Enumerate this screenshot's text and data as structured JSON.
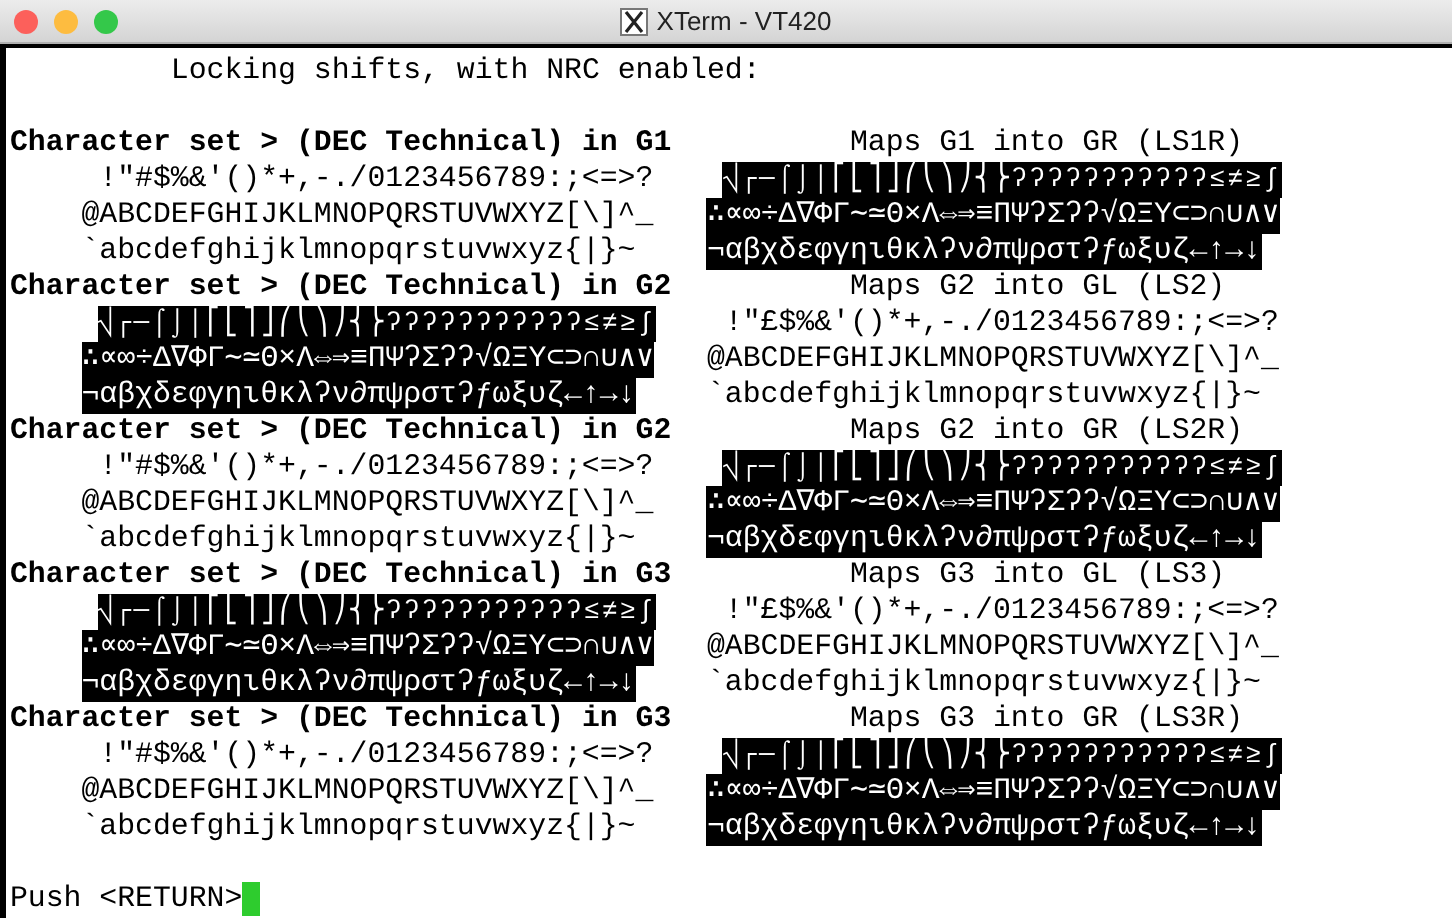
{
  "window": {
    "title": "XTerm - VT420"
  },
  "terminal": {
    "intro": "Locking shifts, with NRC enabled:",
    "blocks": [
      {
        "heading": "Character set > (DEC Technical) in G1",
        "map_label": "Maps G1 into GR (LS1R)",
        "left": {
          "kind": "normal",
          "rows": [
            "!\"#$%&'()*+,-./0123456789:;<=>?",
            "@ABCDEFGHIJKLMNOPQRSTUVWXYZ[\\]^_",
            "`abcdefghijklmnopqrstuvwxyz{|}~"
          ]
        },
        "right": {
          "kind": "inverse",
          "rows": [
            "⎷┌─⌠⌡│⎡⎣⎤⎦⎛⎝⎞⎠⎨⎬ʔʔʔʔʔʔʔʔʔʔʔ≤≠≥∫",
            "∴∝∞÷Δ∇ΦΓ∼≃Θ×Λ⇔⇒≡ΠΨʔΣʔʔ√ΩΞΥ⊂⊃∩∪∧∨",
            "¬αβχδεφγηιθκλʔν∂πψρστʔƒωξυζ←↑→↓"
          ]
        }
      },
      {
        "heading": "Character set > (DEC Technical) in G2",
        "map_label": "Maps G2 into GL (LS2)",
        "left": {
          "kind": "inverse",
          "rows": [
            "⎷┌─⌠⌡│⎡⎣⎤⎦⎛⎝⎞⎠⎨⎬ʔʔʔʔʔʔʔʔʔʔʔ≤≠≥∫",
            "∴∝∞÷Δ∇ΦΓ∼≃Θ×Λ⇔⇒≡ΠΨʔΣʔʔ√ΩΞΥ⊂⊃∩∪∧∨",
            "¬αβχδεφγηιθκλʔν∂πψρστʔƒωξυζ←↑→↓"
          ]
        },
        "right": {
          "kind": "normal",
          "rows": [
            "!\"£$%&'()*+,-./0123456789:;<=>?",
            "@ABCDEFGHIJKLMNOPQRSTUVWXYZ[\\]^_",
            "`abcdefghijklmnopqrstuvwxyz{|}~"
          ]
        }
      },
      {
        "heading": "Character set > (DEC Technical) in G2",
        "map_label": "Maps G2 into GR (LS2R)",
        "left": {
          "kind": "normal",
          "rows": [
            "!\"#$%&'()*+,-./0123456789:;<=>?",
            "@ABCDEFGHIJKLMNOPQRSTUVWXYZ[\\]^_",
            "`abcdefghijklmnopqrstuvwxyz{|}~"
          ]
        },
        "right": {
          "kind": "inverse",
          "rows": [
            "⎷┌─⌠⌡│⎡⎣⎤⎦⎛⎝⎞⎠⎨⎬ʔʔʔʔʔʔʔʔʔʔʔ≤≠≥∫",
            "∴∝∞÷Δ∇ΦΓ∼≃Θ×Λ⇔⇒≡ΠΨʔΣʔʔ√ΩΞΥ⊂⊃∩∪∧∨",
            "¬αβχδεφγηιθκλʔν∂πψρστʔƒωξυζ←↑→↓"
          ]
        }
      },
      {
        "heading": "Character set > (DEC Technical) in G3",
        "map_label": "Maps G3 into GL (LS3)",
        "left": {
          "kind": "inverse",
          "rows": [
            "⎷┌─⌠⌡│⎡⎣⎤⎦⎛⎝⎞⎠⎨⎬ʔʔʔʔʔʔʔʔʔʔʔ≤≠≥∫",
            "∴∝∞÷Δ∇ΦΓ∼≃Θ×Λ⇔⇒≡ΠΨʔΣʔʔ√ΩΞΥ⊂⊃∩∪∧∨",
            "¬αβχδεφγηιθκλʔν∂πψρστʔƒωξυζ←↑→↓"
          ]
        },
        "right": {
          "kind": "normal",
          "rows": [
            "!\"£$%&'()*+,-./0123456789:;<=>?",
            "@ABCDEFGHIJKLMNOPQRSTUVWXYZ[\\]^_",
            "`abcdefghijklmnopqrstuvwxyz{|}~"
          ]
        }
      },
      {
        "heading": "Character set > (DEC Technical) in G3",
        "map_label": "Maps G3 into GR (LS3R)",
        "left": {
          "kind": "normal",
          "rows": [
            "!\"#$%&'()*+,-./0123456789:;<=>?",
            "@ABCDEFGHIJKLMNOPQRSTUVWXYZ[\\]^_",
            "`abcdefghijklmnopqrstuvwxyz{|}~"
          ]
        },
        "right": {
          "kind": "inverse",
          "rows": [
            "⎷┌─⌠⌡│⎡⎣⎤⎦⎛⎝⎞⎠⎨⎬ʔʔʔʔʔʔʔʔʔʔʔ≤≠≥∫",
            "∴∝∞÷Δ∇ΦΓ∼≃Θ×Λ⇔⇒≡ΠΨʔΣʔʔ√ΩΞΥ⊂⊃∩∪∧∨",
            "¬αβχδεφγηιθκλʔν∂πψρστʔƒωξυζ←↑→↓"
          ]
        }
      }
    ],
    "prompt": "Push <RETURN>",
    "cursor": true
  }
}
